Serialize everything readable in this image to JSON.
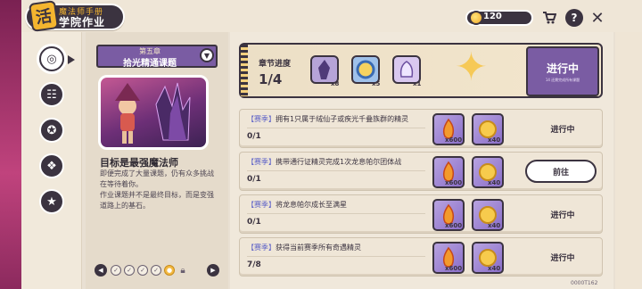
{
  "header": {
    "logo_badge": "活",
    "logo_sub": "魔法师手册",
    "logo_main": "学院作业",
    "coins": "120"
  },
  "rail": {
    "items": [
      {
        "icon": "target-icon",
        "active": true
      },
      {
        "icon": "ticket-icon",
        "active": false
      },
      {
        "icon": "badge-icon",
        "active": false
      },
      {
        "icon": "scroll-icon",
        "active": false
      },
      {
        "icon": "star-badge-icon",
        "active": false
      }
    ]
  },
  "story": {
    "chapter_num": "第五章",
    "chapter_name": "拾光精通课题",
    "title": "目标是最强魔法师",
    "desc_1": "即便完成了大量课题，仍有众多挑战在等待着你。",
    "desc_2": "作业课题并不是最终目标，而是变强道路上的基石。"
  },
  "progress": {
    "label": "章节进度",
    "count": "1/4",
    "rewards": [
      {
        "qty": "x8",
        "color": "#b6a4d8"
      },
      {
        "qty": "x5",
        "color": "#9fc1ea"
      },
      {
        "qty": "x1",
        "color": "#d9c8ef"
      }
    ],
    "status": "进行中",
    "status_sub": "14 还需完成所有课题"
  },
  "tasks": [
    {
      "tag": "【赛季】",
      "text": "拥有1只属于绒仙子或疾光千叠族群的精灵",
      "count": "0/1",
      "r1_qty": "x600",
      "r2_qty": "x40",
      "status": "进行中",
      "button": false
    },
    {
      "tag": "【赛季】",
      "text": "携带通行证精灵完成1次龙息帕尔团体战",
      "count": "0/1",
      "r1_qty": "x600",
      "r2_qty": "x40",
      "status": "前往",
      "button": true
    },
    {
      "tag": "【赛季】",
      "text": "将龙息帕尔成长至满星",
      "count": "0/1",
      "r1_qty": "x600",
      "r2_qty": "x40",
      "status": "进行中",
      "button": false
    },
    {
      "tag": "【赛季】",
      "text": "获得当前赛季所有奇遇精灵",
      "count": "7/8",
      "r1_qty": "x600",
      "r2_qty": "x40",
      "status": "进行中",
      "button": false
    }
  ],
  "uid": "0000T162",
  "colors": {
    "dark": "#3b3340",
    "purple": "#7a5ca3",
    "gold": "#f4b52f",
    "tag": "#5a5fc7"
  }
}
